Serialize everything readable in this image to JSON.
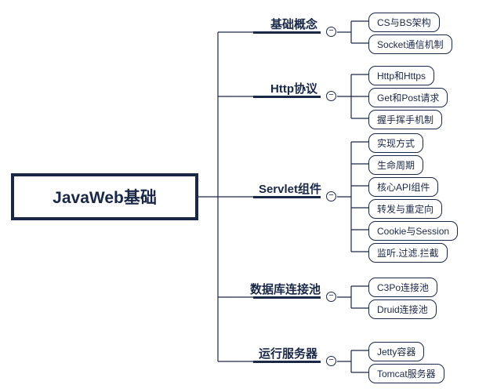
{
  "root": {
    "title": "JavaWeb基础"
  },
  "branches": [
    {
      "id": "basic",
      "label": "基础概念",
      "children": [
        {
          "id": "cs-bs",
          "label": "CS与BS架构"
        },
        {
          "id": "socket",
          "label": "Socket通信机制"
        }
      ]
    },
    {
      "id": "http",
      "label": "Http协议",
      "children": [
        {
          "id": "http-https",
          "label": "Http和Https"
        },
        {
          "id": "get-post",
          "label": "Get和Post请求"
        },
        {
          "id": "handshake",
          "label": "握手挥手机制"
        }
      ]
    },
    {
      "id": "servlet",
      "label": "Servlet组件",
      "children": [
        {
          "id": "impl",
          "label": "实现方式"
        },
        {
          "id": "lifecycle",
          "label": "生命周期"
        },
        {
          "id": "api",
          "label": "核心API组件"
        },
        {
          "id": "forward",
          "label": "转发与重定向"
        },
        {
          "id": "cookie",
          "label": "Cookie与Session"
        },
        {
          "id": "filter",
          "label": "监听.过滤.拦截"
        }
      ]
    },
    {
      "id": "dbpool",
      "label": "数据库连接池",
      "children": [
        {
          "id": "c3p0",
          "label": "C3Po连接池"
        },
        {
          "id": "druid",
          "label": "Druid连接池"
        }
      ]
    },
    {
      "id": "server",
      "label": "运行服务器",
      "children": [
        {
          "id": "jetty",
          "label": "Jetty容器"
        },
        {
          "id": "tomcat",
          "label": "Tomcat服务器"
        }
      ]
    }
  ],
  "toggle_symbol": "−"
}
